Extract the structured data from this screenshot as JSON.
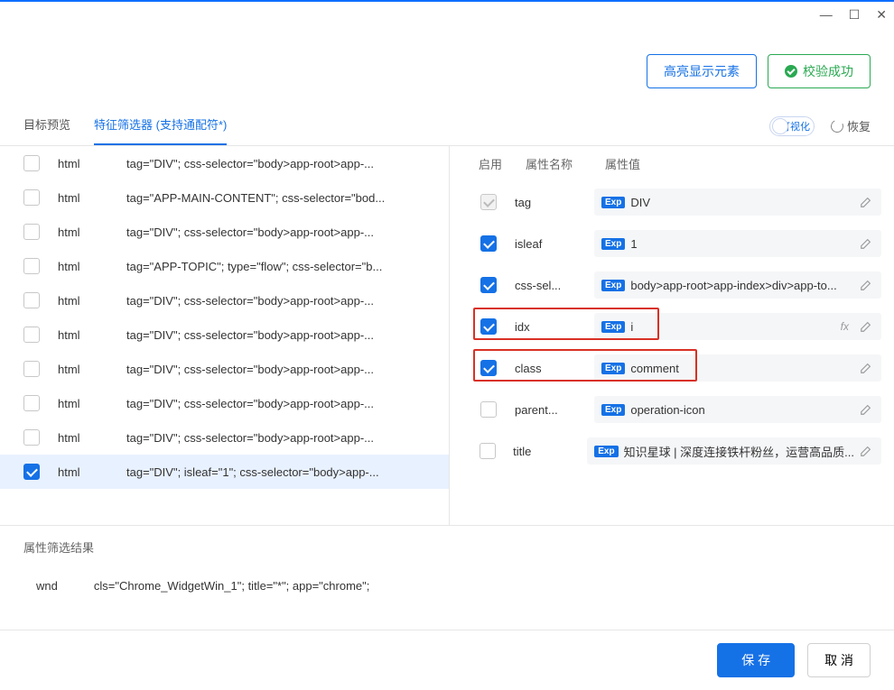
{
  "titlebar": {
    "min": "—",
    "max": "☐",
    "close": "✕"
  },
  "header": {
    "highlight_btn": "高亮显示元素",
    "validate_btn": "校验成功"
  },
  "tabs": {
    "preview": "目标预览",
    "filter": "特征筛选器 (支持通配符*)",
    "visual_toggle": "可视化",
    "restore": "恢复"
  },
  "left_rows": [
    {
      "checked": false,
      "type": "html",
      "desc": "tag=\"DIV\"; css-selector=\"body>app-root>app-..."
    },
    {
      "checked": false,
      "type": "html",
      "desc": "tag=\"APP-MAIN-CONTENT\"; css-selector=\"bod..."
    },
    {
      "checked": false,
      "type": "html",
      "desc": "tag=\"DIV\"; css-selector=\"body>app-root>app-..."
    },
    {
      "checked": false,
      "type": "html",
      "desc": "tag=\"APP-TOPIC\"; type=\"flow\"; css-selector=\"b..."
    },
    {
      "checked": false,
      "type": "html",
      "desc": "tag=\"DIV\"; css-selector=\"body>app-root>app-..."
    },
    {
      "checked": false,
      "type": "html",
      "desc": "tag=\"DIV\"; css-selector=\"body>app-root>app-..."
    },
    {
      "checked": false,
      "type": "html",
      "desc": "tag=\"DIV\"; css-selector=\"body>app-root>app-..."
    },
    {
      "checked": false,
      "type": "html",
      "desc": "tag=\"DIV\"; css-selector=\"body>app-root>app-..."
    },
    {
      "checked": false,
      "type": "html",
      "desc": "tag=\"DIV\"; css-selector=\"body>app-root>app-..."
    },
    {
      "checked": true,
      "type": "html",
      "desc": "tag=\"DIV\"; isleaf=\"1\"; css-selector=\"body>app-..."
    }
  ],
  "prop_headers": {
    "enable": "启用",
    "name": "属性名称",
    "value": "属性值"
  },
  "props": [
    {
      "enabled": true,
      "disabled_look": true,
      "name": "tag",
      "value": "DIV",
      "has_fx": false,
      "highlight": false
    },
    {
      "enabled": true,
      "disabled_look": false,
      "name": "isleaf",
      "value": "1",
      "has_fx": false,
      "highlight": false
    },
    {
      "enabled": true,
      "disabled_look": false,
      "name": "css-sel...",
      "value": "body>app-root>app-index>div>app-to...",
      "has_fx": false,
      "highlight": false
    },
    {
      "enabled": true,
      "disabled_look": false,
      "name": "idx",
      "value": "i",
      "has_fx": true,
      "highlight": true
    },
    {
      "enabled": true,
      "disabled_look": false,
      "name": "class",
      "value": "comment",
      "has_fx": false,
      "highlight": true
    },
    {
      "enabled": false,
      "disabled_look": false,
      "name": "parent...",
      "value": "operation-icon",
      "has_fx": false,
      "highlight": false
    },
    {
      "enabled": false,
      "disabled_look": false,
      "name": "title",
      "value": "知识星球 | 深度连接铁杆粉丝，运营高品质...",
      "has_fx": false,
      "highlight": false
    }
  ],
  "exp_label": "Exp",
  "result": {
    "title": "属性筛选结果",
    "label": "wnd",
    "value": "cls=\"Chrome_WidgetWin_1\"; title=\"*\"; app=\"chrome\";"
  },
  "footer": {
    "save": "保 存",
    "cancel": "取 消"
  },
  "fx_label": "fx"
}
